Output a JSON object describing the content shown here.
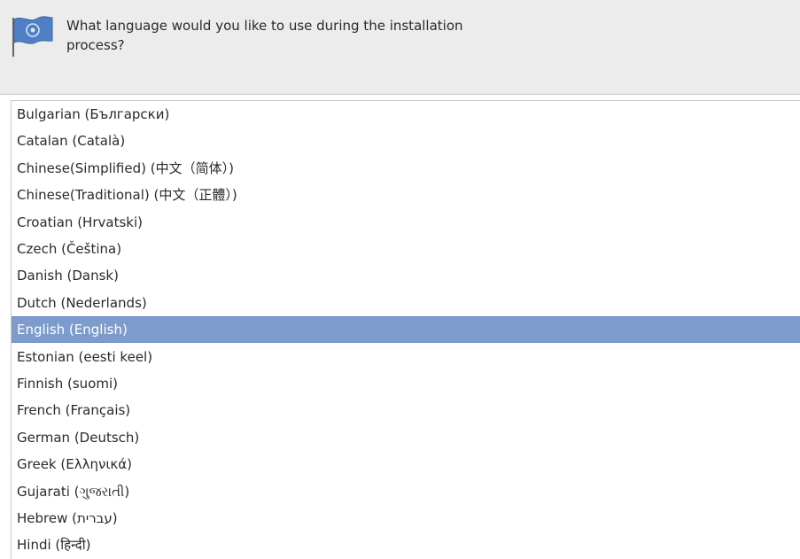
{
  "header": {
    "prompt": "What language would you like to use during the installation process?"
  },
  "languages": {
    "selected": "English (English)",
    "items": [
      "Bulgarian (Български)",
      "Catalan (Català)",
      "Chinese(Simplified) (中文（简体）)",
      "Chinese(Traditional) (中文（正體）)",
      "Croatian (Hrvatski)",
      "Czech (Čeština)",
      "Danish (Dansk)",
      "Dutch (Nederlands)",
      "English (English)",
      "Estonian (eesti keel)",
      "Finnish (suomi)",
      "French (Français)",
      "German (Deutsch)",
      "Greek (Ελληνικά)",
      "Gujarati (ગુજરાતી)",
      "Hebrew (עברית)",
      "Hindi (हिन्दी)"
    ]
  },
  "colors": {
    "selection": "#7d9ccd",
    "header_bg": "#ececec"
  },
  "icons": {
    "header": "flag-icon"
  }
}
